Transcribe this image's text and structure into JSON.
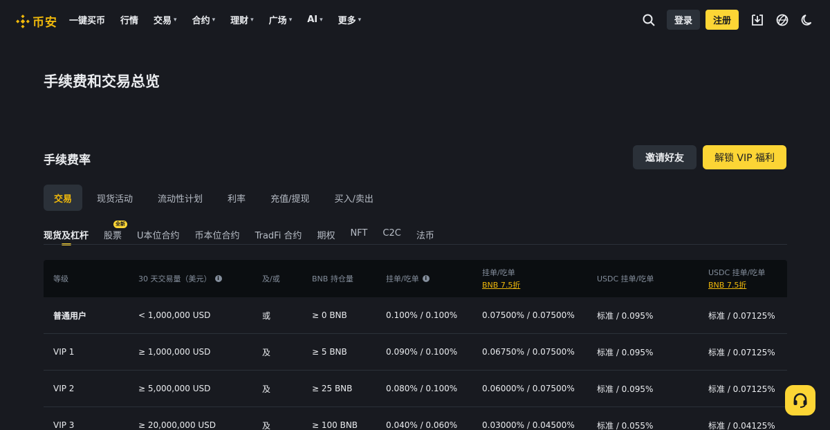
{
  "brand": {
    "name": "币安",
    "accent": "#f0b90b",
    "button_yellow": "#fcd535"
  },
  "nav": {
    "items": [
      {
        "label": "一键买币",
        "dropdown": false
      },
      {
        "label": "行情",
        "dropdown": false
      },
      {
        "label": "交易",
        "dropdown": true
      },
      {
        "label": "合约",
        "dropdown": true
      },
      {
        "label": "理财",
        "dropdown": true
      },
      {
        "label": "广场",
        "dropdown": true
      },
      {
        "label": "AI",
        "dropdown": true
      },
      {
        "label": "更多",
        "dropdown": true
      }
    ],
    "login": "登录",
    "register": "注册",
    "icons": [
      "search-icon",
      "download-icon",
      "globe-icon",
      "moon-icon"
    ]
  },
  "page_title": "手续费和交易总览",
  "section": {
    "title": "手续费率",
    "invite_button": "邀请好友",
    "vip_button": "解锁 VIP 福利"
  },
  "category_tabs": [
    "交易",
    "现货活动",
    "流动性计划",
    "利率",
    "充值/提现",
    "买入/卖出"
  ],
  "category_active": "交易",
  "sub_tabs": [
    "现货及杠杆",
    "股票",
    "U本位合约",
    "币本位合约",
    "TradFi 合约",
    "期权",
    "NFT",
    "C2C",
    "法币"
  ],
  "sub_active": "现货及杠杆",
  "sub_badge": {
    "tab": "股票",
    "text": "全新"
  },
  "table": {
    "headers": {
      "level": "等级",
      "volume": "30 天交易量（美元）",
      "andor": "及/或",
      "bnb": "BNB 持仓量",
      "maker_taker": "挂单/吃单",
      "maker_taker_bnb": "挂单/吃单",
      "maker_taker_bnb_link": "BNB 7.5折",
      "usdc": "USDC 挂单/吃单",
      "usdc_bnb": "USDC 挂单/吃单",
      "usdc_bnb_link": "BNB 7.5折"
    },
    "rows": [
      {
        "level": "普通用户",
        "volume": "< 1,000,000 USD",
        "andor": "或",
        "bnb": "≥ 0 BNB",
        "fee": "0.100% / 0.100%",
        "fee_bnb": "0.07500% / 0.07500%",
        "usdc": "标准 / 0.095%",
        "usdc_bnb": "标准 / 0.07125%"
      },
      {
        "level": "VIP 1",
        "volume": "≥ 1,000,000 USD",
        "andor": "及",
        "bnb": "≥ 5 BNB",
        "fee": "0.090% / 0.100%",
        "fee_bnb": "0.06750% / 0.07500%",
        "usdc": "标准 / 0.095%",
        "usdc_bnb": "标准 / 0.07125%"
      },
      {
        "level": "VIP 2",
        "volume": "≥ 5,000,000 USD",
        "andor": "及",
        "bnb": "≥ 25 BNB",
        "fee": "0.080% / 0.100%",
        "fee_bnb": "0.06000% / 0.07500%",
        "usdc": "标准 / 0.095%",
        "usdc_bnb": "标准 / 0.07125%"
      },
      {
        "level": "VIP 3",
        "volume": "≥ 20,000,000 USD",
        "andor": "及",
        "bnb": "≥ 100 BNB",
        "fee": "0.040% / 0.060%",
        "fee_bnb": "0.03000% / 0.04500%",
        "usdc": "标准 / 0.055%",
        "usdc_bnb": "标准 / 0.04125%"
      }
    ]
  },
  "support_icon": "headset-icon"
}
